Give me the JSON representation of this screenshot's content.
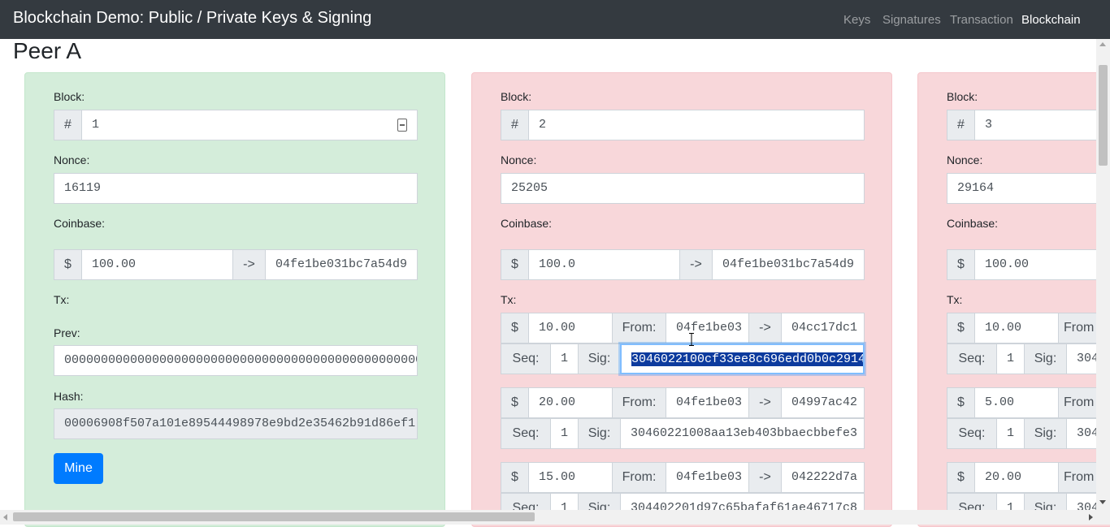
{
  "navbar": {
    "brand": "Blockchain Demo: Public / Private Keys & Signing",
    "links": [
      "Keys",
      "Signatures",
      "Transaction",
      "Blockchain"
    ],
    "active_link": "Blockchain"
  },
  "peer": "Peer A",
  "labels": {
    "block": "Block:",
    "nonce": "Nonce:",
    "coinbase": "Coinbase:",
    "tx": "Tx:",
    "prev": "Prev:",
    "hash": "Hash:",
    "hash_symbol": "#",
    "dollar": "$",
    "arrow": "->",
    "from": "From:",
    "seq": "Seq:",
    "sig": "Sig:",
    "mine": "Mine"
  },
  "colors": {
    "valid_block": "#d4edda",
    "invalid_block": "#f8d7da",
    "navbar": "#343a40",
    "mine_button": "#007bff"
  },
  "blocks": [
    {
      "number": "1",
      "nonce": "16119",
      "coinbase_amount": "100.00",
      "coinbase_to": "04fe1be031bc7a54d9",
      "prev": "0000000000000000000000000000000000000000000000000000000000000000",
      "hash": "00006908f507a101e89544498978e9bd2e35462b91d86ef1",
      "txs": []
    },
    {
      "number": "2",
      "nonce": "25205",
      "coinbase_amount": "100.0",
      "coinbase_to": "04fe1be031bc7a54d9",
      "txs": [
        {
          "amount": "10.00",
          "from": "04fe1be03",
          "to": "04cc17dc1",
          "seq": "1",
          "sig": "3046022100cf33ee8c696edd0b0c2914"
        },
        {
          "amount": "20.00",
          "from": "04fe1be03",
          "to": "04997ac42",
          "seq": "1",
          "sig": "30460221008aa13eb403bbaecbbefe3"
        },
        {
          "amount": "15.00",
          "from": "04fe1be03",
          "to": "042222d7a",
          "seq": "1",
          "sig": "304402201d97c65bafaf61ae46717c8"
        }
      ]
    },
    {
      "number": "3",
      "nonce": "29164",
      "coinbase_amount": "100.00",
      "txs": [
        {
          "amount": "10.00",
          "from": "From",
          "seq": "1",
          "sig": "304"
        },
        {
          "amount": "5.00",
          "from": "From",
          "seq": "1",
          "sig": "304"
        },
        {
          "amount": "20.00",
          "from": "From",
          "seq": "1",
          "sig": "304"
        }
      ]
    }
  ]
}
